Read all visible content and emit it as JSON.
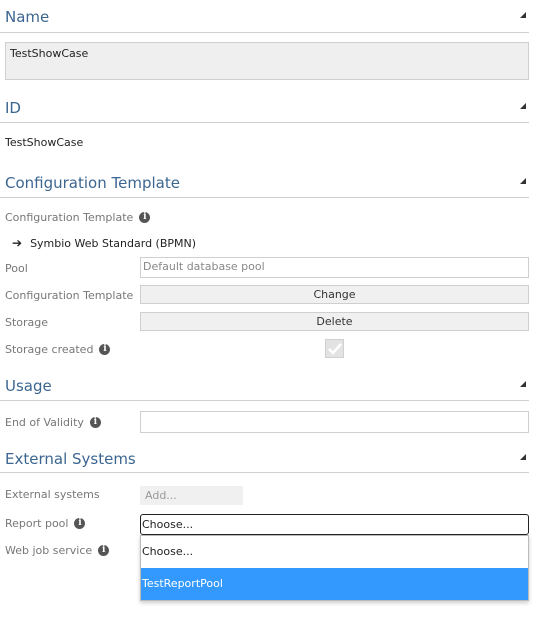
{
  "sections": {
    "name": {
      "title": "Name",
      "value": "TestShowCase"
    },
    "id": {
      "title": "ID",
      "value": "TestShowCase"
    },
    "config": {
      "title": "Configuration Template",
      "template_label": "Configuration Template",
      "template_link": "Symbio Web Standard (BPMN)",
      "pool_label": "Pool",
      "pool_value": "Default database pool",
      "config_template_label": "Configuration Template",
      "change_label": "Change",
      "storage_label": "Storage",
      "delete_label": "Delete",
      "storage_created_label": "Storage created"
    },
    "usage": {
      "title": "Usage",
      "validity_label": "End of Validity",
      "validity_value": ""
    },
    "external": {
      "title": "External Systems",
      "systems_label": "External systems",
      "add_label": "Add...",
      "report_pool_label": "Report pool",
      "report_pool_value": "Choose...",
      "web_job_label": "Web job service",
      "dropdown_options": [
        "Choose...",
        "TestReportPool"
      ],
      "selected_option": "TestReportPool"
    }
  },
  "colors": {
    "title": "#3c6690",
    "highlight": "#3399ff"
  }
}
